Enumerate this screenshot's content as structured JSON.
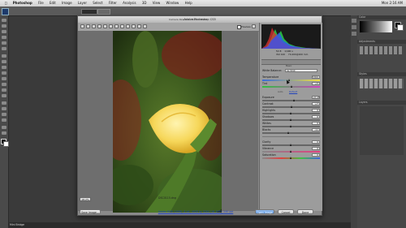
{
  "menubar": {
    "items": [
      "Photoshop",
      "File",
      "Edit",
      "Image",
      "Layer",
      "Select",
      "Filter",
      "Analysis",
      "3D",
      "View",
      "Window",
      "Help"
    ],
    "clock": "Mon 2:16 AM"
  },
  "dialog": {
    "title": "Adobe Photoshop CS5",
    "subtitle": "Camera Raw 6.0 - Nikon D5100",
    "preview_label": "Preview",
    "zoom": "18.2%",
    "filename": "DSC0115.dng",
    "camera_info": {
      "aperture": "f/2.8",
      "shutter": "1/400 s",
      "iso": "ISO 100",
      "lens": "70-200@200 mm"
    },
    "tab_label": "Basic",
    "white_balance": {
      "label": "White Balance:",
      "value": "As Shot"
    },
    "sliders": [
      {
        "label": "Temperature",
        "value": "5300",
        "pos": 0.48
      },
      {
        "label": "Tint",
        "value": "+5",
        "pos": 0.52
      },
      {
        "label": "Exposure",
        "value": "+0.45",
        "pos": 0.56
      },
      {
        "label": "Contrast",
        "value": "+7",
        "pos": 0.52
      },
      {
        "label": "Highlights",
        "value": "0",
        "pos": 0.5
      },
      {
        "label": "Shadows",
        "value": "0",
        "pos": 0.5
      },
      {
        "label": "Whites",
        "value": "0",
        "pos": 0.5
      },
      {
        "label": "Blacks",
        "value": "-11",
        "pos": 0.46
      },
      {
        "label": "Clarity",
        "value": "0",
        "pos": 0.5
      },
      {
        "label": "Vibrance",
        "value": "0",
        "pos": 0.5
      },
      {
        "label": "Saturation",
        "value": "0",
        "pos": 0.5
      }
    ],
    "auto_label": "Auto",
    "default_label": "Default",
    "save_button": "Save Image...",
    "workflow_link": "Adobe RGB (1998); 8 bit; 4928 by 3264 (16.1MP); 240 ppi",
    "open_button": "Open Image",
    "cancel_button": "Cancel",
    "done_button": "Done"
  },
  "panels": {
    "top": "Adjustments",
    "mid": "Styles",
    "bottom": "Layers"
  },
  "statusbar": {
    "label": "Mini Bridge"
  },
  "icons": [
    "zoom-icon",
    "hand-icon",
    "white-balance-icon",
    "color-sampler-icon",
    "crop-icon",
    "straighten-icon",
    "red-eye-icon",
    "brush-icon",
    "rotate-icon",
    "trash-icon"
  ]
}
